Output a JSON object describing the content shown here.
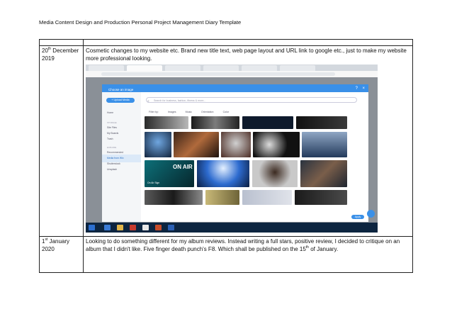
{
  "document": {
    "header": "Media Content Design and Production Personal Project Management Diary Template"
  },
  "entries": [
    {
      "date_prefix": "20",
      "date_sup": "th",
      "date_rest": " December 2019",
      "text": "Cosmetic changes to my website etc. Brand new title text, web page layout and URL link to google etc., just to make my website more professional looking."
    },
    {
      "date_prefix": "1",
      "date_sup": "st",
      "date_rest": " January 2020",
      "text_a": "Looking to do something different for my album reviews. Instead writing a full stars, positive review, I decided to critique on an album that I didn't like. Five finger death punch's F8. Which shall be published on the 15",
      "text_sup": "th",
      "text_b": " of January."
    }
  ],
  "screenshot": {
    "dialog_title": "Choose an image",
    "upload_label": "+ Upload Media",
    "search_placeholder": "Search for business, fashion, fitness & more...",
    "filter_label": "Filter by:",
    "filters": [
      "Images",
      "Music",
      "Orientation",
      "Color"
    ],
    "sidebar": {
      "home": "Home",
      "section1": "STORAGE",
      "site_files": "Site Files",
      "my_boards": "My Boards",
      "trash": "Trash",
      "section2": "EXPLORE",
      "recommended": "Recommended",
      "media_from_wix": "Media from Wix",
      "shutterstock": "Shutterstock",
      "unsplash": "Unsplash"
    },
    "thumb_text_on_air": "ON AIR",
    "thumb_text_small": "On Air Sign",
    "apply_label": "Apply",
    "colors": {
      "accent": "#3a90e8",
      "taskbar": "#0d2540"
    }
  }
}
